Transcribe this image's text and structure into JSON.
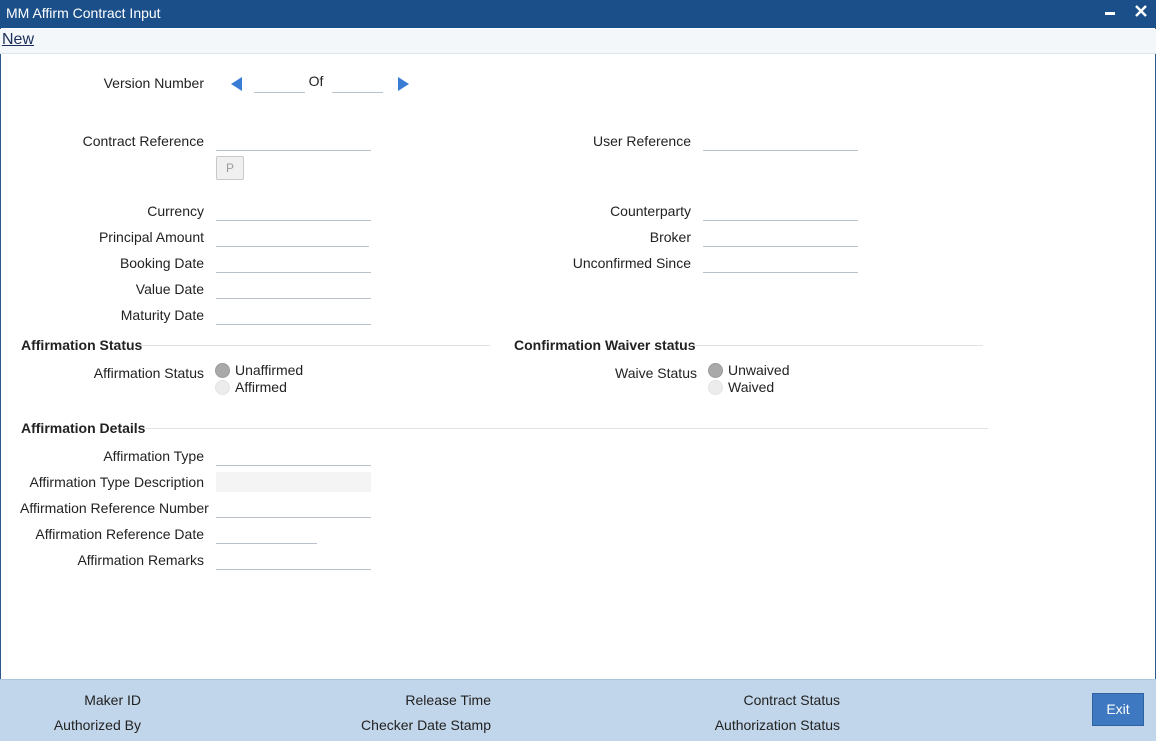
{
  "window": {
    "title": "MM Affirm Contract Input",
    "minimize_icon": "minimize-icon",
    "close_icon": "close-icon"
  },
  "toolbar": {
    "new_label": "New"
  },
  "version": {
    "label": "Version Number",
    "of_label": "Of",
    "current": "",
    "total": ""
  },
  "contract": {
    "contract_reference_label": "Contract Reference",
    "p_button_label": "P",
    "user_reference_label": "User Reference",
    "currency_label": "Currency",
    "principal_amount_label": "Principal Amount",
    "booking_date_label": "Booking Date",
    "value_date_label": "Value Date",
    "maturity_date_label": "Maturity Date",
    "counterparty_label": "Counterparty",
    "broker_label": "Broker",
    "unconfirmed_since_label": "Unconfirmed Since"
  },
  "affirmation_status": {
    "section_title": "Affirmation Status",
    "label": "Affirmation Status",
    "options": [
      "Unaffirmed",
      "Affirmed"
    ],
    "selected": "Unaffirmed"
  },
  "waiver_status": {
    "section_title": "Confirmation Waiver status",
    "label": "Waive Status",
    "options": [
      "Unwaived",
      "Waived"
    ],
    "selected": "Unwaived"
  },
  "affirmation_details": {
    "section_title": "Affirmation Details",
    "type_label": "Affirmation Type",
    "type_description_label": "Affirmation Type Description",
    "reference_number_label": "Affirmation Reference Number",
    "reference_date_label": "Affirmation Reference Date",
    "remarks_label": "Affirmation Remarks"
  },
  "footer": {
    "maker_id_label": "Maker ID",
    "authorized_by_label": "Authorized By",
    "release_time_label": "Release Time",
    "checker_date_stamp_label": "Checker Date Stamp",
    "contract_status_label": "Contract Status",
    "authorization_status_label": "Authorization Status",
    "exit_label": "Exit"
  }
}
